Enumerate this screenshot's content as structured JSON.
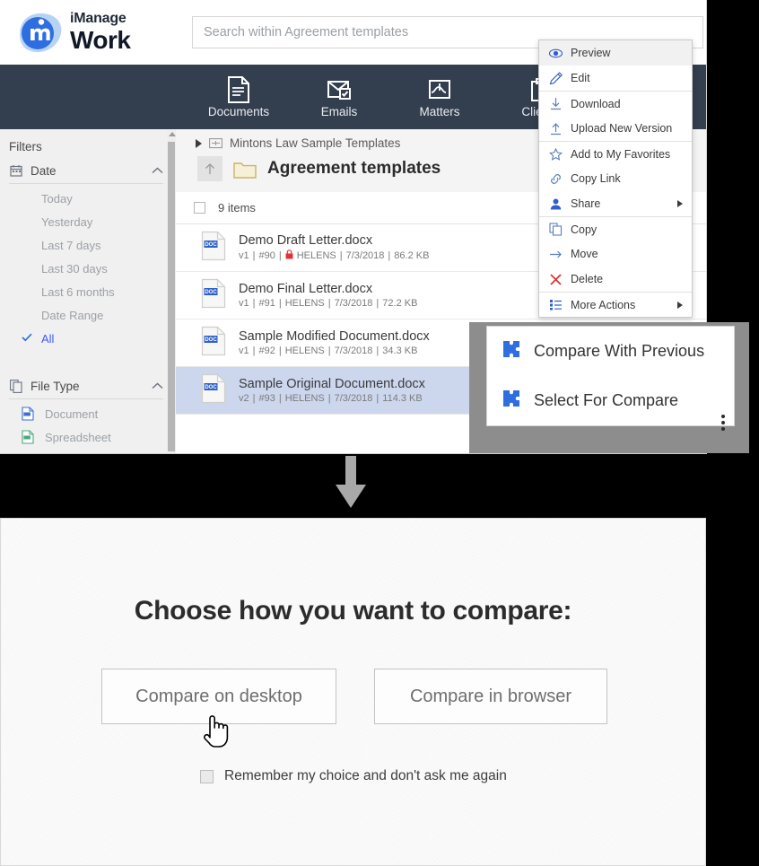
{
  "app": {
    "brand_line1": "iManage",
    "brand_line2": "Work",
    "logo_icon": "imanage-m-logo-icon"
  },
  "search": {
    "placeholder": "Search within Agreement templates",
    "value": ""
  },
  "nav": {
    "items": [
      {
        "label": "Documents",
        "icon": "document-icon"
      },
      {
        "label": "Emails",
        "icon": "email-check-icon"
      },
      {
        "label": "Matters",
        "icon": "matters-icon"
      },
      {
        "label": "Clients",
        "icon": "clients-icon"
      }
    ]
  },
  "sidebar": {
    "title": "Filters",
    "groups": [
      {
        "label": "Date",
        "icon": "calendar-icon",
        "chevron": "chevron-up-icon",
        "options": [
          {
            "label": "Today",
            "selected": false
          },
          {
            "label": "Yesterday",
            "selected": false
          },
          {
            "label": "Last 7 days",
            "selected": false
          },
          {
            "label": "Last 30 days",
            "selected": false
          },
          {
            "label": "Last 6 months",
            "selected": false
          },
          {
            "label": "Date Range",
            "selected": false
          },
          {
            "label": "All",
            "selected": true
          }
        ]
      },
      {
        "label": "File Type",
        "icon": "file-type-icon",
        "chevron": "chevron-up-icon",
        "options": [
          {
            "label": "Document",
            "icon": "doc-file-icon",
            "selected": false
          },
          {
            "label": "Spreadsheet",
            "icon": "xls-file-icon",
            "selected": false
          }
        ]
      }
    ]
  },
  "breadcrumb": {
    "parent": "Mintons Law Sample Templates",
    "parent_icon": "workspace-icon",
    "expand_icon": "triangle-right-icon",
    "up_icon": "arrow-up-icon",
    "folder_icon": "folder-icon",
    "folder_title": "Agreement templates"
  },
  "list": {
    "select_all_label": "",
    "items_count": "9 items",
    "documents": [
      {
        "icon": "doc-file-icon",
        "name": "Demo Draft Letter.docx",
        "version": "v1",
        "number": "#90",
        "locked": true,
        "lock_icon": "lock-icon",
        "author": "HELENS",
        "date": "7/3/2018",
        "size": "86.2 KB",
        "selected": false
      },
      {
        "icon": "doc-file-icon",
        "name": "Demo Final Letter.docx",
        "version": "v1",
        "number": "#91",
        "locked": false,
        "author": "HELENS",
        "date": "7/3/2018",
        "size": "72.2 KB",
        "selected": false
      },
      {
        "icon": "doc-file-icon",
        "name": "Sample Modified Document.docx",
        "version": "v1",
        "number": "#92",
        "locked": false,
        "author": "HELENS",
        "date": "7/3/2018",
        "size": "34.3 KB",
        "selected": false
      },
      {
        "icon": "doc-file-icon",
        "name": "Sample Original Document.docx",
        "version": "v2",
        "number": "#93",
        "locked": false,
        "author": "HELENS",
        "date": "7/3/2018",
        "size": "114.3 KB",
        "selected": true
      }
    ]
  },
  "context_menu": {
    "items": [
      {
        "label": "Preview",
        "icon": "eye-icon",
        "highlighted": true,
        "submenu": false
      },
      {
        "label": "Edit",
        "icon": "pencil-icon",
        "highlighted": false,
        "submenu": false
      },
      {
        "label": "Download",
        "icon": "download-icon",
        "highlighted": false,
        "submenu": false
      },
      {
        "label": "Upload New Version",
        "icon": "upload-icon",
        "highlighted": false,
        "submenu": false
      },
      {
        "label": "Add to My Favorites",
        "icon": "star-icon",
        "highlighted": false,
        "submenu": false
      },
      {
        "label": "Copy Link",
        "icon": "link-icon",
        "highlighted": false,
        "submenu": false
      },
      {
        "label": "Share",
        "icon": "person-share-icon",
        "highlighted": false,
        "submenu": true
      },
      {
        "label": "Copy",
        "icon": "copy-icon",
        "highlighted": false,
        "submenu": false
      },
      {
        "label": "Move",
        "icon": "arrow-right-icon",
        "highlighted": false,
        "submenu": false
      },
      {
        "label": "Delete",
        "icon": "x-delete-icon",
        "highlighted": false,
        "submenu": false
      },
      {
        "label": "More Actions",
        "icon": "list-actions-icon",
        "highlighted": false,
        "submenu": true
      }
    ]
  },
  "submenu": {
    "items": [
      {
        "label": "Compare With Previous",
        "icon": "puzzle-piece-icon"
      },
      {
        "label": "Select For Compare",
        "icon": "puzzle-piece-icon"
      }
    ]
  },
  "kebab_menu": {
    "icon": "kebab-menu-icon"
  },
  "flow_arrow": {
    "icon": "arrow-down-icon",
    "color": "#a8a8a8"
  },
  "compare_dialog": {
    "title": "Choose how you want to compare:",
    "desktop_button": "Compare on desktop",
    "browser_button": "Compare in browser",
    "remember_label": "Remember my choice and don't ask me again",
    "remember_checked": false,
    "cursor": "hand-pointer-cursor"
  },
  "colors": {
    "nav_bar": "#333e4e",
    "accent_blue": "#3d5afe",
    "selected_row": "#ccd7ee",
    "delete_red": "#e03434",
    "lock_red": "#e03434"
  }
}
